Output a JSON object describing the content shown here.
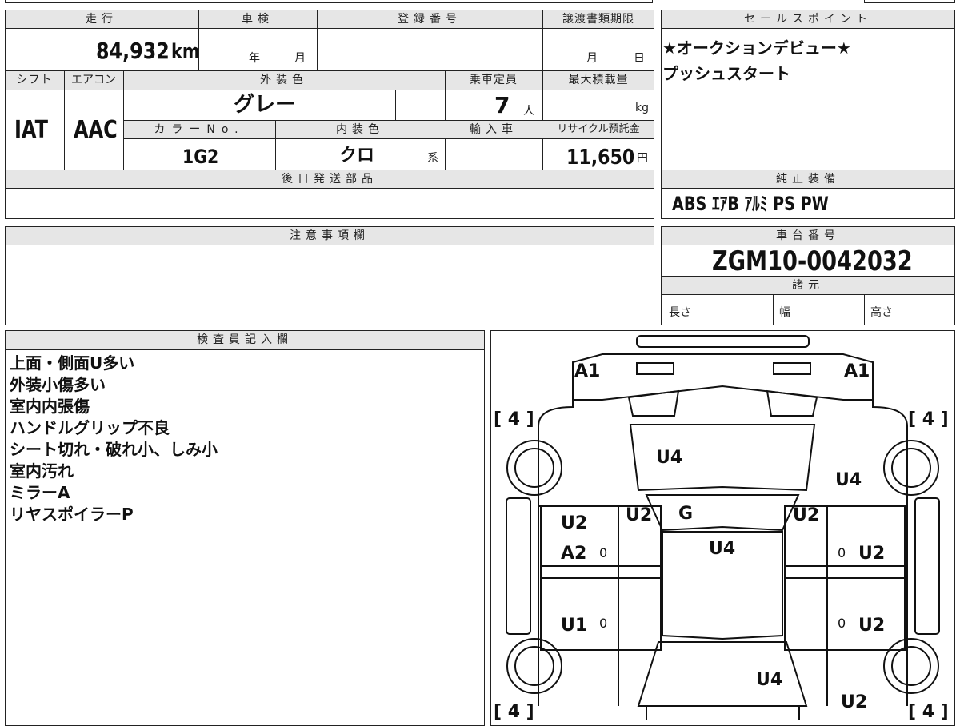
{
  "top_table": {
    "labels": {
      "mileage": "走行",
      "inspection": "車検",
      "registration_no": "登録番号",
      "transfer_deadline": "譲渡書類期限",
      "shift": "シフト",
      "aircon": "エアコン",
      "exterior_color": "外装色",
      "capacity": "乗車定員",
      "max_load": "最大積載量",
      "color_no": "カラーNo.",
      "interior_color": "内装色",
      "import": "輸入車",
      "recycle_fee": "リサイクル預託金",
      "later_parts": "後日発送部品"
    },
    "values": {
      "mileage": "84,932",
      "mileage_unit": "km",
      "inspection_year_unit": "年",
      "inspection_month_unit": "月",
      "deadline_month_unit": "月",
      "deadline_day_unit": "日",
      "shift": "IAT",
      "aircon": "AAC",
      "exterior_color": "グレー",
      "capacity": "7",
      "capacity_unit": "人",
      "max_load_unit": "kg",
      "color_no": "1G2",
      "interior_color": "クロ",
      "interior_suffix": "系",
      "recycle_fee": "11,650",
      "recycle_unit": "円"
    }
  },
  "sales_points": {
    "title": "セールスポイント",
    "lines": [
      "★オークションデビュー★",
      "プッシュスタート"
    ]
  },
  "equipment": {
    "title": "純正装備",
    "value": "ABS ｴｱB ｱﾙﾐ PS PW"
  },
  "notes_section": {
    "title": "注意事項欄"
  },
  "chassis": {
    "title": "車台番号",
    "value": "ZGM10-0042032",
    "specs_title": "諸元",
    "length": "長さ",
    "width": "幅",
    "height": "高さ"
  },
  "inspector": {
    "title": "検査員記入欄",
    "lines": [
      "上面・側面U多い",
      "外装小傷多い",
      "室内内張傷",
      "ハンドルグリップ不良",
      "シート切れ・破れ小、しみ小",
      "室内汚れ",
      "ミラーA",
      "リヤスポイラーP"
    ]
  },
  "diagram": {
    "tire_fl": "[ 4 ]",
    "tire_fr": "[ 4 ]",
    "tire_rl": "[ 4 ]",
    "tire_rr": "[ 4 ]",
    "a1_left": "A1",
    "a1_right": "A1",
    "hood": "U4",
    "right_fender": "U4",
    "left_pillar": "U2",
    "glass": "G",
    "right_pillar": "U2",
    "roof": "U4",
    "left_front_door_1": "U2",
    "left_front_door_2": "A2",
    "right_front_door": "U2",
    "left_rear_door": "U1",
    "right_rear_door": "U2",
    "rear": "U4",
    "rear_right": "U2",
    "zero_1": "0",
    "zero_2": "0",
    "zero_3": "0",
    "zero_4": "0"
  }
}
